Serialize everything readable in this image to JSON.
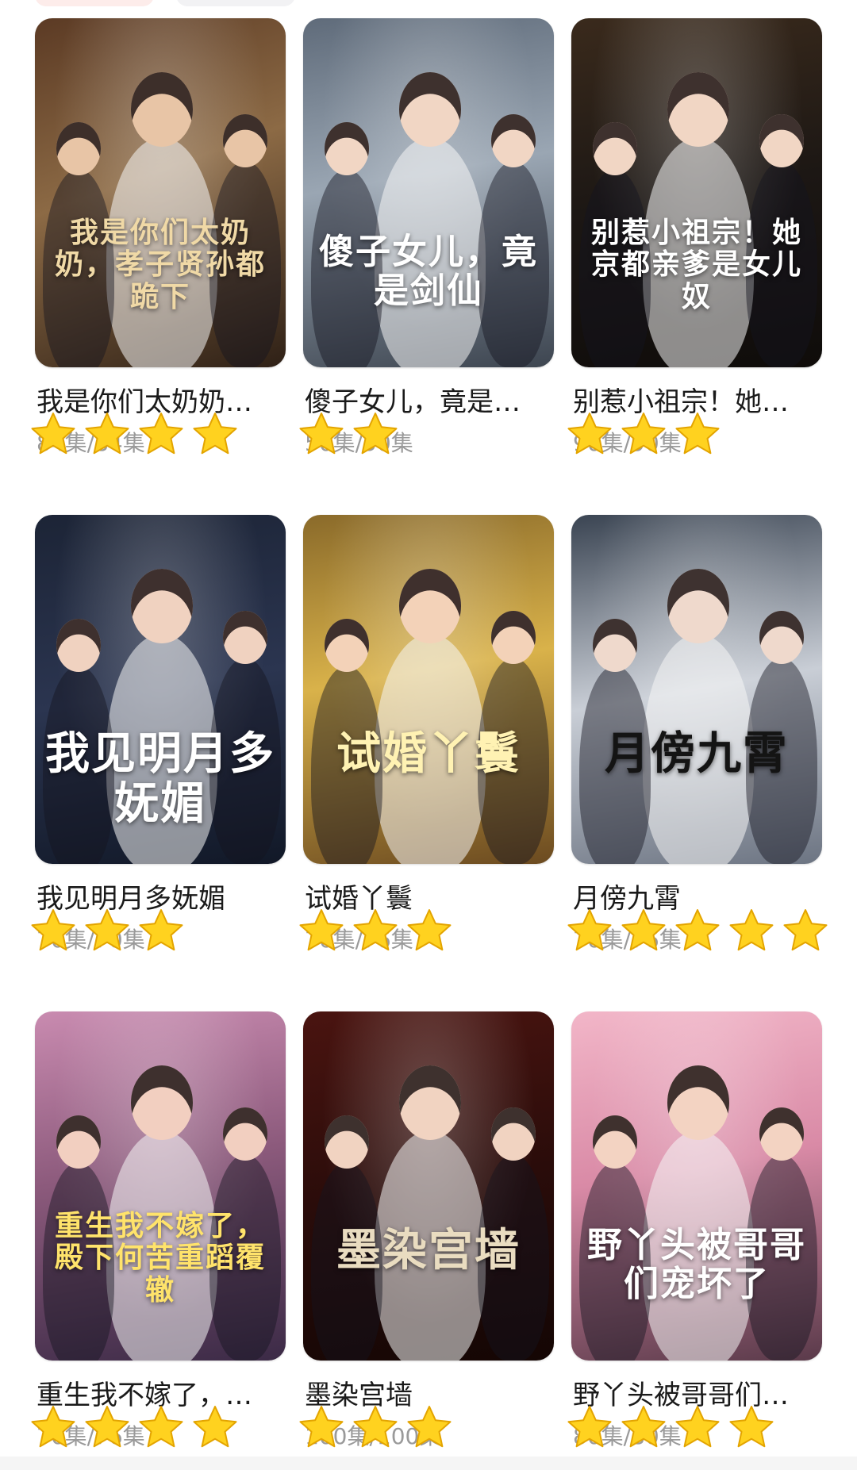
{
  "colors": {
    "star_fill": "#FFD21F",
    "star_stroke": "#E3A400",
    "episode_text": "#9a9a9a",
    "title_text": "#1a1a1a"
  },
  "dramas": [
    {
      "title": "我是你们太奶奶…",
      "episodes": "84集/84集",
      "poster_art": "我是你们太奶奶，孝子贤孙都跪下",
      "rating": 4,
      "theme": {
        "bg": "linear-gradient(160deg,#5b3a24 0%,#8c6a45 45%,#2e2016 100%)",
        "accent": "#f0d9a6",
        "skin": "#e8c5a6"
      }
    },
    {
      "title": "傻子女儿，竟是…",
      "episodes": "50集/50集",
      "poster_art": "傻子女儿，竟是剑仙",
      "rating": 2,
      "theme": {
        "bg": "linear-gradient(170deg,#5f6b7a 0%,#9aa6b3 45%,#3d4550 100%)",
        "accent": "#ffffff",
        "skin": "#f1d6c4"
      }
    },
    {
      "title": "别惹小祖宗！她…",
      "episodes": "90集/90集",
      "poster_art": "别惹小祖宗！她京都亲爹是女儿奴",
      "rating": 3,
      "theme": {
        "bg": "linear-gradient(170deg,#3a2a1c 0%,#1c1714 50%,#0f0c0a 100%)",
        "accent": "#ffffff",
        "skin": "#f1d6c4"
      }
    },
    {
      "title": "我见明月多妩媚",
      "episodes": "70集/70集",
      "poster_art": "我见明月多妩媚",
      "rating": 3,
      "theme": {
        "bg": "linear-gradient(170deg,#1c2436 0%,#2b3550 50%,#111827 100%)",
        "accent": "#ffffff",
        "skin": "#f0d2c0"
      }
    },
    {
      "title": "试婚丫鬟",
      "episodes": "76集/76集",
      "poster_art": "试婚丫鬟",
      "rating": 3,
      "theme": {
        "bg": "linear-gradient(170deg,#8a6a2a 0%,#d9b24a 45%,#6b4a20 100%)",
        "accent": "#fff2b3",
        "skin": "#f3d2b8"
      }
    },
    {
      "title": "月傍九霄",
      "episodes": "76集/76集",
      "poster_art": "月傍九霄",
      "rating": 5,
      "theme": {
        "bg": "linear-gradient(170deg,#3a4452 0%,#c9ced6 50%,#6c7482 100%)",
        "accent": "#141414",
        "skin": "#efd9cc"
      }
    },
    {
      "title": "重生我不嫁了，…",
      "episodes": "76集/76集",
      "poster_art": "重生我不嫁了，殿下何苦重蹈覆辙",
      "rating": 4,
      "theme": {
        "bg": "linear-gradient(170deg,#c98bb0 0%,#8c5a7c 45%,#3b2a46 100%)",
        "accent": "#ffe36b",
        "skin": "#f2cfc0"
      }
    },
    {
      "title": "墨染宫墙",
      "episodes": "100集/100集",
      "poster_art": "墨染宫墙",
      "rating": 3,
      "theme": {
        "bg": "linear-gradient(170deg,#4a1410 0%,#2a0c0a 50%,#140604 100%)",
        "accent": "#e9dcc0",
        "skin": "#f1d3c1"
      }
    },
    {
      "title": "野丫头被哥哥们…",
      "episodes": "80集/80集",
      "poster_art": "野丫头被哥哥们宠坏了",
      "rating": 4,
      "theme": {
        "bg": "linear-gradient(170deg,#f2b6c8 0%,#d98aa6 45%,#5a3a4a 100%)",
        "accent": "#ffffff",
        "skin": "#f3d3c2"
      }
    }
  ]
}
